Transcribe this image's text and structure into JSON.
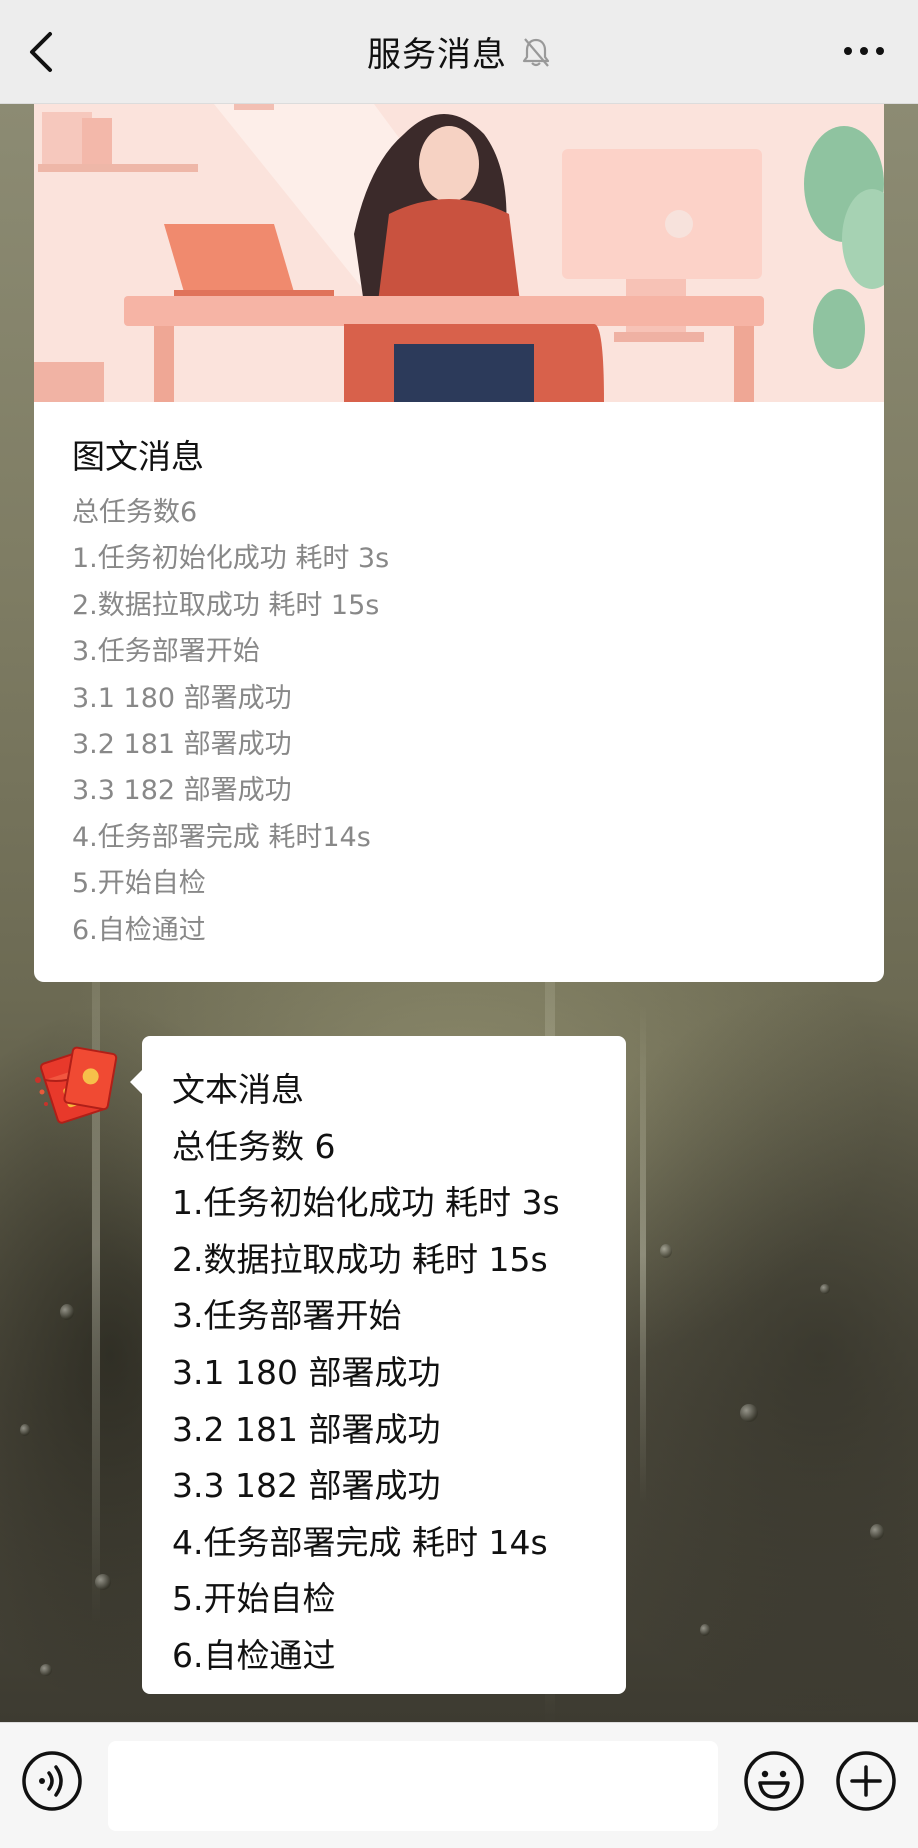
{
  "header": {
    "title": "服务消息",
    "icons": {
      "back": "chevron-left-icon",
      "mute": "bell-muted-icon",
      "more": "more-dots-icon"
    }
  },
  "article": {
    "title": "图文消息",
    "lines": [
      "总任务数6",
      "1.任务初始化成功 耗时 3s",
      "2.数据拉取成功 耗时 15s",
      "3.任务部署开始",
      "3.1 180 部署成功",
      "3.2 181 部署成功",
      "3.3 182 部署成功",
      "4.任务部署完成 耗时14s",
      "5.开始自检",
      "6.自检通过"
    ]
  },
  "text_message": {
    "lines": [
      "文本消息",
      "总任务数 6",
      "1.任务初始化成功 耗时 3s",
      "2.数据拉取成功 耗时 15s",
      "3.任务部署开始",
      "3.1 180 部署成功",
      "3.2 181 部署成功",
      "3.3 182 部署成功",
      "4.任务部署完成 耗时 14s",
      "5.开始自检",
      "6.自检通过"
    ]
  },
  "input_bar": {
    "placeholder": "",
    "icons": {
      "voice": "voice-icon",
      "emoji": "emoji-icon",
      "plus": "plus-icon"
    }
  },
  "colors": {
    "topbar_bg": "#ededed",
    "card_bg": "#ffffff",
    "article_text": "#888888",
    "message_text": "#111111"
  }
}
